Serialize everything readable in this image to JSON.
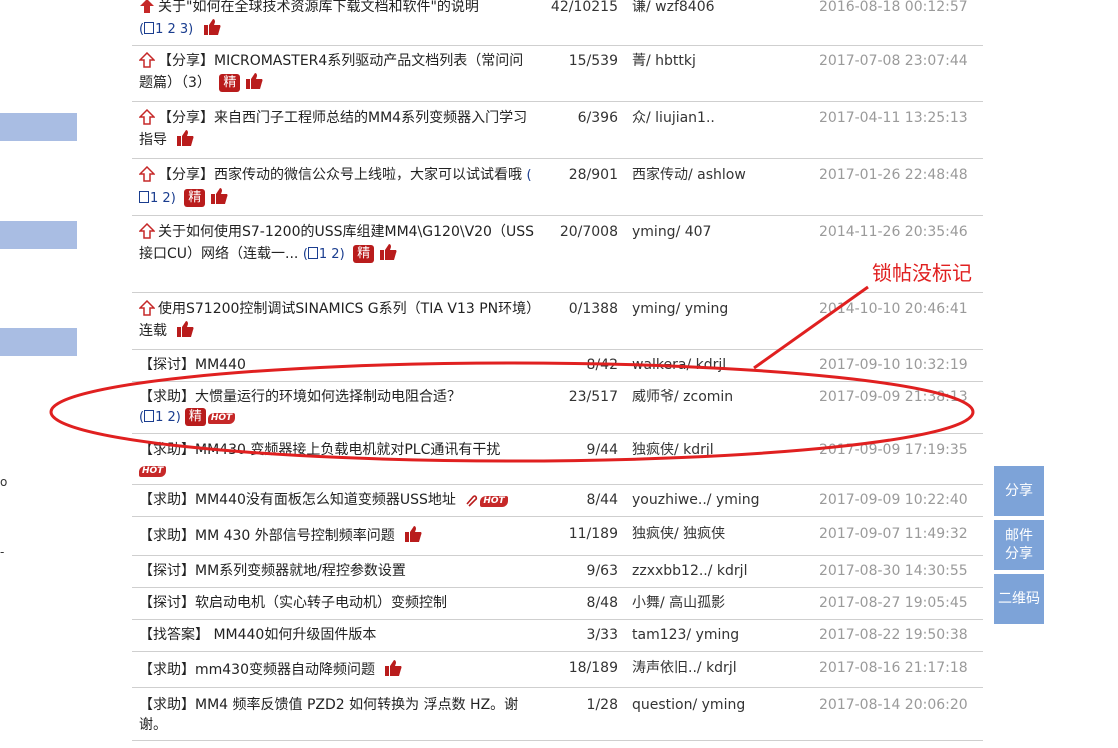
{
  "threads": [
    {
      "title": "关于\"如何在全球技术资源库下载文档和软件\"的说明",
      "pages": "1 2 3",
      "count": "42/10215",
      "author": "谦/ wzf8406",
      "time": "2016-08-18 00:12:57"
    },
    {
      "title": "【分享】MICROMASTER4系列驱动产品文档列表（常问问题篇）（3）",
      "count": "15/539",
      "author": "菁/ hbttkj",
      "time": "2017-07-08 23:07:44"
    },
    {
      "title": "【分享】来自西门子工程师总结的MM4系列变频器入门学习指导",
      "count": "6/396",
      "author": "众/ liujian1..",
      "time": "2017-04-11 13:25:13"
    },
    {
      "title": "【分享】西家传动的微信公众号上线啦，大家可以试试看哦",
      "pages": "1 2",
      "count": "28/901",
      "author": "西家传动/ ashlow",
      "time": "2017-01-26 22:48:48"
    },
    {
      "title": "关于如何使用S7-1200的USS库组建MM4\\G120\\V20（USS接口CU）网络（连载一...",
      "pages": "1 2",
      "count": "20/7008",
      "author": "yming/ 407",
      "time": "2014-11-26 20:35:46"
    },
    {
      "title": "使用S71200控制调试SINAMICS G系列（TIA V13 PN环境）连载",
      "count": "0/1388",
      "author": "yming/ yming",
      "time": "2014-10-10 20:46:41"
    },
    {
      "title": "【探讨】MM440",
      "count": "8/42",
      "author": "walkera/ kdrjl",
      "time": "2017-09-10 10:32:19"
    },
    {
      "title": "【求助】大惯量运行的环境如何选择制动电阻合适？",
      "pages": "1 2",
      "count": "23/517",
      "author": "威师爷/ zcomin",
      "time": "2017-09-09 21:38:13"
    },
    {
      "title": "【求助】MM430 变频器接上负载电机就对PLC通讯有干扰",
      "count": "9/44",
      "author": "独疯侠/ kdrjl",
      "time": "2017-09-09 17:19:35"
    },
    {
      "title": "【求助】MM440没有面板怎么知道变频器USS地址",
      "count": "8/44",
      "author": "youzhiwe../ yming",
      "time": "2017-09-09 10:22:40"
    },
    {
      "title": "【求助】MM 430 外部信号控制频率问题",
      "count": "11/189",
      "author": "独疯侠/ 独疯侠",
      "time": "2017-09-07 11:49:32"
    },
    {
      "title": "【探讨】MM系列变频器就地/程控参数设置",
      "count": "9/63",
      "author": "zzxxbb12../ kdrjl",
      "time": "2017-08-30 14:30:55"
    },
    {
      "title": "【探讨】软启动电机（实心转子电动机）变频控制",
      "count": "8/48",
      "author": "小舞/ 高山孤影",
      "time": "2017-08-27 19:05:45"
    },
    {
      "title": "【找答案】 MM440如何升级固件版本",
      "count": "3/33",
      "author": "tam123/ yming",
      "time": "2017-08-22 19:50:38"
    },
    {
      "title": "【求助】mm430变频器自动降频问题",
      "count": "18/189",
      "author": "涛声依旧../ kdrjl",
      "time": "2017-08-16 21:17:18"
    },
    {
      "title": "【求助】MM4 频率反馈值 PZD2 如何转换为 浮点数 HZ。谢谢。",
      "count": "1/28",
      "author": "question/ yming",
      "time": "2017-08-14 20:06:20"
    }
  ],
  "badges": {
    "jing": "精",
    "hot": "HOT"
  },
  "annotation": {
    "text": "锁帖没标记"
  },
  "side_buttons": {
    "share": "分享",
    "email": "邮件分享",
    "qrcode": "二维码"
  },
  "edge_glyphs": {
    "a": "o",
    "b": "-"
  }
}
